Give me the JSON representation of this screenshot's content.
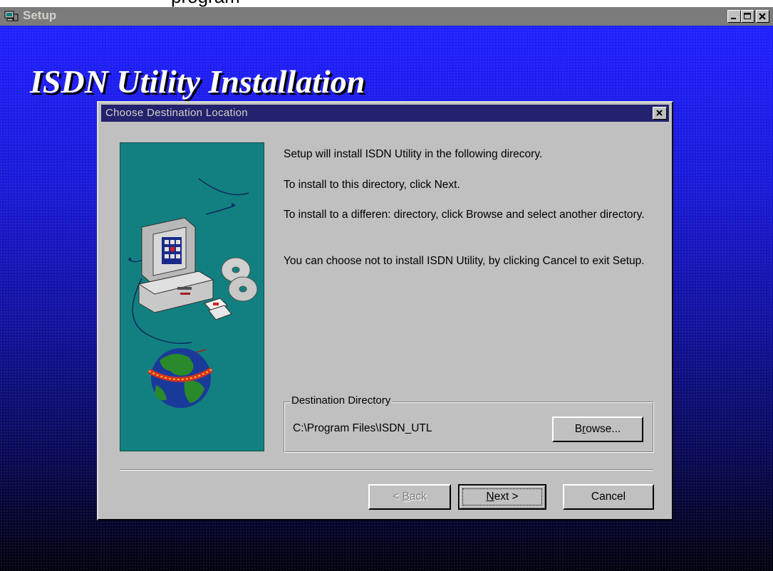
{
  "above_text": "program",
  "window": {
    "title": "Setup",
    "controls": [
      "minimize-icon",
      "maximize-icon",
      "close-icon"
    ]
  },
  "banner": {
    "title": "ISDN Utility Installation"
  },
  "dialog": {
    "title": "Choose Destination Location",
    "messages": [
      "Setup will install ISDN Utility in the following direcory.",
      "To install to this directory, click Next.",
      "To install to a differen: directory, click Browse and select another directory.",
      "You can choose not to install ISDN Utility, by clicking Cancel to exit Setup."
    ],
    "destination": {
      "legend": "Destination Directory",
      "path": "C:\\Program Files\\ISDN_UTL",
      "browse_label": "Browse...",
      "browse_mnemonic": "r"
    },
    "buttons": {
      "back_label": "< Back",
      "back_mnemonic": "B",
      "next_label": "Next >",
      "next_mnemonic": "N",
      "cancel_label": "Cancel"
    }
  },
  "colors": {
    "titlebar_inactive": "#7b7b7b",
    "dialog_titlebar": "#22226e",
    "dialog_face": "#c0c0c0",
    "art_panel": "#128080",
    "backdrop_top": "#2020ff",
    "backdrop_bottom": "#02020e"
  }
}
